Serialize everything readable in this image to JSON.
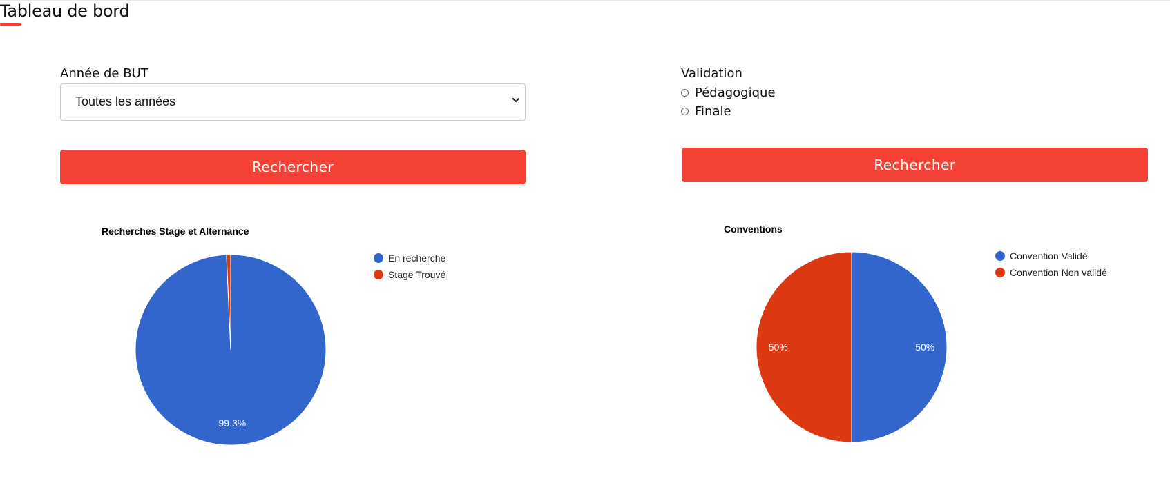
{
  "header": {
    "title": "Tableau de bord"
  },
  "left_panel": {
    "year_label": "Année de BUT",
    "year_select_value": "Toutes les années",
    "search_button": "Rechercher"
  },
  "right_panel": {
    "validation_label": "Validation",
    "radio_options": [
      "Pédagogique",
      "Finale"
    ],
    "search_button": "Rechercher"
  },
  "colors": {
    "accent": "#f44336",
    "blue": "#3366cc",
    "red": "#dc3912"
  },
  "chart_data": [
    {
      "type": "pie",
      "title": "Recherches Stage et Alternance",
      "categories": [
        "En recherche",
        "Stage Trouvé"
      ],
      "values": [
        99.3,
        0.7
      ],
      "data_labels": [
        "99.3%",
        ""
      ],
      "colors": [
        "#3366cc",
        "#dc3912"
      ],
      "legend_position": "right"
    },
    {
      "type": "pie",
      "title": "Conventions",
      "categories": [
        "Convention Validé",
        "Convention Non validé"
      ],
      "values": [
        50,
        50
      ],
      "data_labels": [
        "50%",
        "50%"
      ],
      "colors": [
        "#3366cc",
        "#dc3912"
      ],
      "legend_position": "right"
    }
  ]
}
